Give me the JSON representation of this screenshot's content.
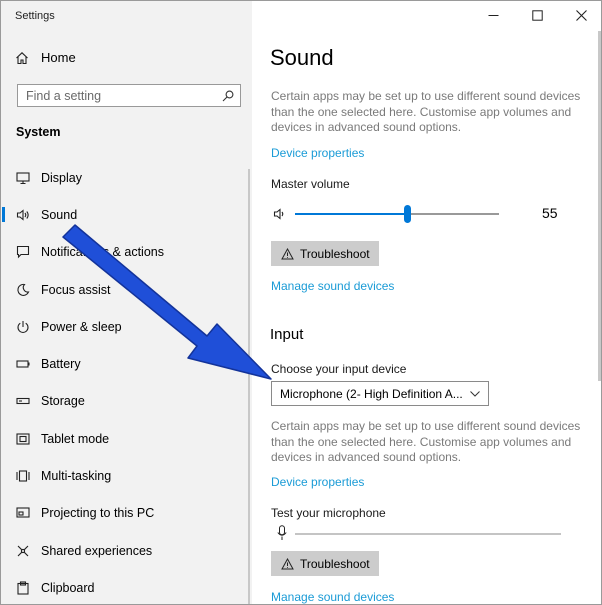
{
  "window": {
    "title": "Settings"
  },
  "sidebar": {
    "home_label": "Home",
    "search_placeholder": "Find a setting",
    "section_label": "System",
    "items": [
      {
        "label": "Display",
        "icon": "monitor-icon"
      },
      {
        "label": "Sound",
        "icon": "speaker-icon",
        "active": true
      },
      {
        "label": "Notifications & actions",
        "icon": "message-icon"
      },
      {
        "label": "Focus assist",
        "icon": "moon-icon"
      },
      {
        "label": "Power & sleep",
        "icon": "power-icon"
      },
      {
        "label": "Battery",
        "icon": "battery-icon"
      },
      {
        "label": "Storage",
        "icon": "storage-icon"
      },
      {
        "label": "Tablet mode",
        "icon": "tablet-icon"
      },
      {
        "label": "Multi-tasking",
        "icon": "multitask-icon"
      },
      {
        "label": "Projecting to this PC",
        "icon": "project-icon"
      },
      {
        "label": "Shared experiences",
        "icon": "shared-icon"
      },
      {
        "label": "Clipboard",
        "icon": "clipboard-icon"
      }
    ]
  },
  "main": {
    "title": "Sound",
    "output": {
      "description": "Certain apps may be set up to use different sound devices than the one selected here. Customise app volumes and devices in advanced sound options.",
      "device_properties_link": "Device properties",
      "master_volume_label": "Master volume",
      "volume_value": "55",
      "volume_fraction": 0.55,
      "troubleshoot_label": "Troubleshoot",
      "manage_devices_link": "Manage sound devices"
    },
    "input": {
      "section_title": "Input",
      "choose_label": "Choose your input device",
      "selected_device": "Microphone (2- High Definition A...",
      "description": "Certain apps may be set up to use different sound devices than the one selected here. Customise app volumes and devices in advanced sound options.",
      "device_properties_link": "Device properties",
      "test_label": "Test your microphone",
      "troubleshoot_label": "Troubleshoot",
      "manage_devices_link": "Manage sound devices"
    }
  },
  "colors": {
    "accent": "#0078d7",
    "link": "#1a9bd6",
    "annotation_arrow": "#1f4fd8"
  }
}
